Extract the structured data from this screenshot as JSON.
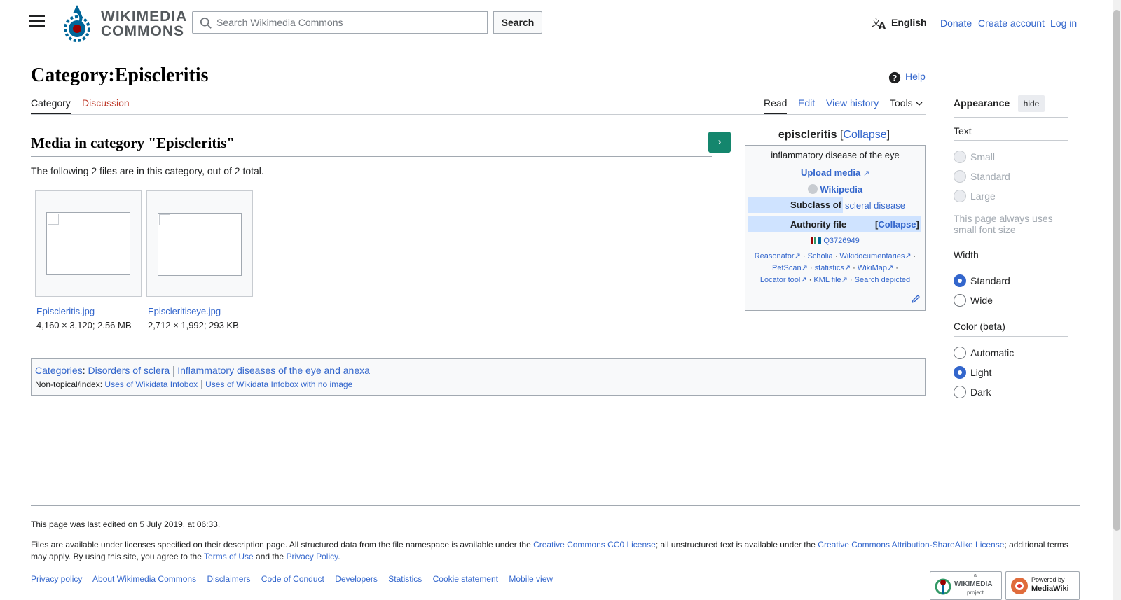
{
  "header": {
    "logo_line1": "WIKIMEDIA",
    "logo_line2": "COMMONS",
    "search_placeholder": "Search Wikimedia Commons",
    "search_button": "Search",
    "language": "English",
    "donate": "Donate",
    "create_account": "Create account",
    "login": "Log in"
  },
  "page": {
    "title": "Category:Episcleritis",
    "help": "Help",
    "tabs": {
      "category": "Category",
      "discussion": "Discussion",
      "read": "Read",
      "edit": "Edit",
      "history": "View history",
      "tools": "Tools"
    }
  },
  "content": {
    "heading": "Media in category \"Episcleritis\"",
    "next_button": "›",
    "count_text": "The following 2 files are in this category, out of 2 total.",
    "files": [
      {
        "name": "Episcleritis.jpg",
        "meta": "4,160 × 3,120; 2.56 MB"
      },
      {
        "name": "Episcleritiseye.jpg",
        "meta": "2,712 × 1,992; 293 KB"
      }
    ]
  },
  "infobox": {
    "title": "episcleritis",
    "collapse": "Collapse",
    "description": "inflammatory disease of the eye",
    "upload_media": "Upload media",
    "wikipedia": "Wikipedia",
    "subclass_label": "Subclass of",
    "subclass_value": "scleral disease",
    "authority_label": "Authority file",
    "qid": "Q3726949",
    "links": [
      "Reasonator",
      "Scholia",
      "Wikidocumentaries",
      "PetScan",
      "statistics",
      "WikiMap",
      "Locator tool",
      "KML file",
      "Search depicted"
    ]
  },
  "categories": {
    "label": "Categories",
    "items": [
      "Disorders of sclera",
      "Inflammatory diseases of the eye and anexa"
    ],
    "hidden_label": "Non-topical/index:",
    "hidden_items": [
      "Uses of Wikidata Infobox",
      "Uses of Wikidata Infobox with no image"
    ]
  },
  "appearance": {
    "title": "Appearance",
    "hide": "hide",
    "text_heading": "Text",
    "text_options": [
      "Small",
      "Standard",
      "Large"
    ],
    "text_note": "This page always uses small font size",
    "width_heading": "Width",
    "width_options": [
      "Standard",
      "Wide"
    ],
    "width_selected": "Standard",
    "color_heading": "Color (beta)",
    "color_options": [
      "Automatic",
      "Light",
      "Dark"
    ],
    "color_selected": "Light"
  },
  "footer": {
    "last_edited": "This page was last edited on 5 July 2019, at 06:33.",
    "license_1": "Files are available under licenses specified on their description page. All structured data from the file namespace is available under the ",
    "cc0": "Creative Commons CC0 License",
    "license_2": "; all unstructured text is available under the ",
    "ccbysa": "Creative Commons Attribution-ShareAlike License",
    "license_3": "; additional terms may apply. By using this site, you agree to the ",
    "terms": "Terms of Use",
    "license_4": " and the ",
    "privacy": "Privacy Policy",
    "license_5": ".",
    "links": [
      "Privacy policy",
      "About Wikimedia Commons",
      "Disclaimers",
      "Code of Conduct",
      "Developers",
      "Statistics",
      "Cookie statement",
      "Mobile view"
    ],
    "badge_wikimedia_top": "a",
    "badge_wikimedia": "WIKIMEDIA",
    "badge_wikimedia_sub": "project",
    "badge_mediawiki_top": "Powered by",
    "badge_mediawiki": "MediaWiki"
  },
  "colors": {
    "link": "#3366cc",
    "red_link": "#bf3c2c",
    "green": "#14866d",
    "band": "#cfe3ff"
  }
}
